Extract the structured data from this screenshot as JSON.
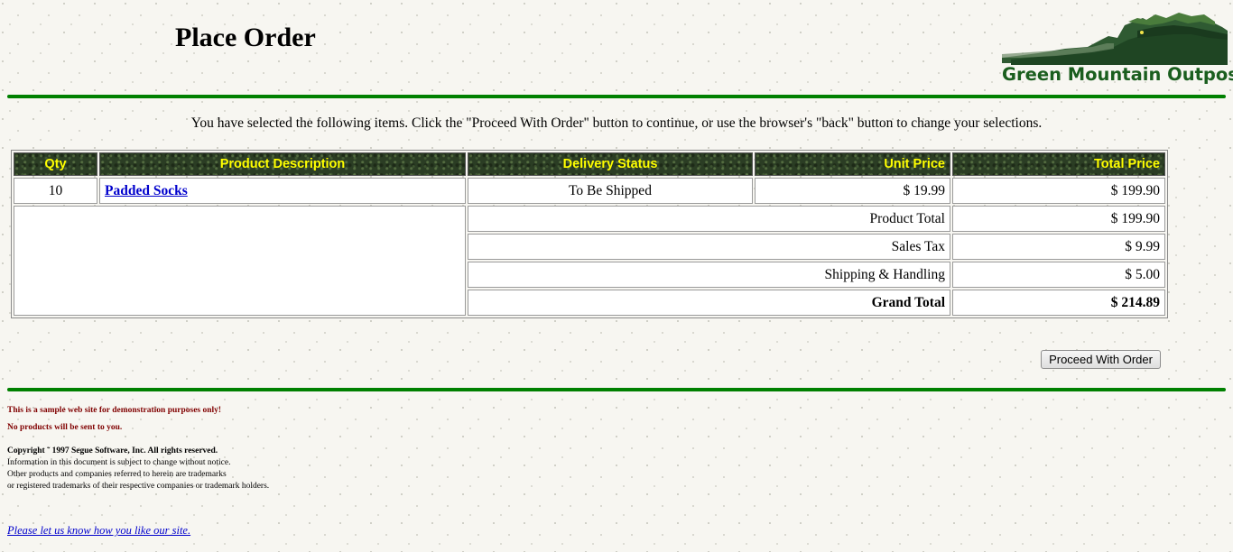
{
  "header": {
    "title": "Place Order",
    "logo_text": "Green Mountain Outpost"
  },
  "intro_text": "You have selected the following items. Click the \"Proceed With Order\" button to continue, or use the browser's \"back\" button to change your selections.",
  "table": {
    "headers": {
      "qty": "Qty",
      "description": "Product Description",
      "delivery": "Delivery Status",
      "unit_price": "Unit Price",
      "total_price": "Total Price"
    },
    "items": [
      {
        "qty": "10",
        "description": "Padded Socks",
        "delivery": "To Be Shipped",
        "unit_price": "$ 19.99",
        "total_price": "$ 199.90"
      }
    ],
    "summary": [
      {
        "label": "Product Total",
        "value": "$ 199.90"
      },
      {
        "label": "Sales Tax",
        "value": "$ 9.99"
      },
      {
        "label": "Shipping & Handling",
        "value": "$ 5.00"
      },
      {
        "label": "Grand Total",
        "value": "$ 214.89"
      }
    ]
  },
  "button": {
    "proceed_label": "Proceed With Order"
  },
  "footer": {
    "disclaimer_1": "This is a sample web site for demonstration purposes only!",
    "disclaimer_2": "No products will be sent to you.",
    "copyright": "Copyright ˜ 1997 Segue Software, Inc. All rights reserved.",
    "notice_1": "Information in this document is subject to change without notice.",
    "notice_2": "Other products and companies referred to herein are trademarks",
    "notice_3": "or registered trademarks of their respective companies or trademark holders.",
    "feedback_link": "Please let us know how you like our site."
  },
  "colors": {
    "rule": "#008000",
    "header_text": "#ffff00",
    "header_bg": "#2b3d24",
    "link": "#0000cc",
    "disclaimer": "#800000",
    "logo_text": "#1a5e1e"
  }
}
